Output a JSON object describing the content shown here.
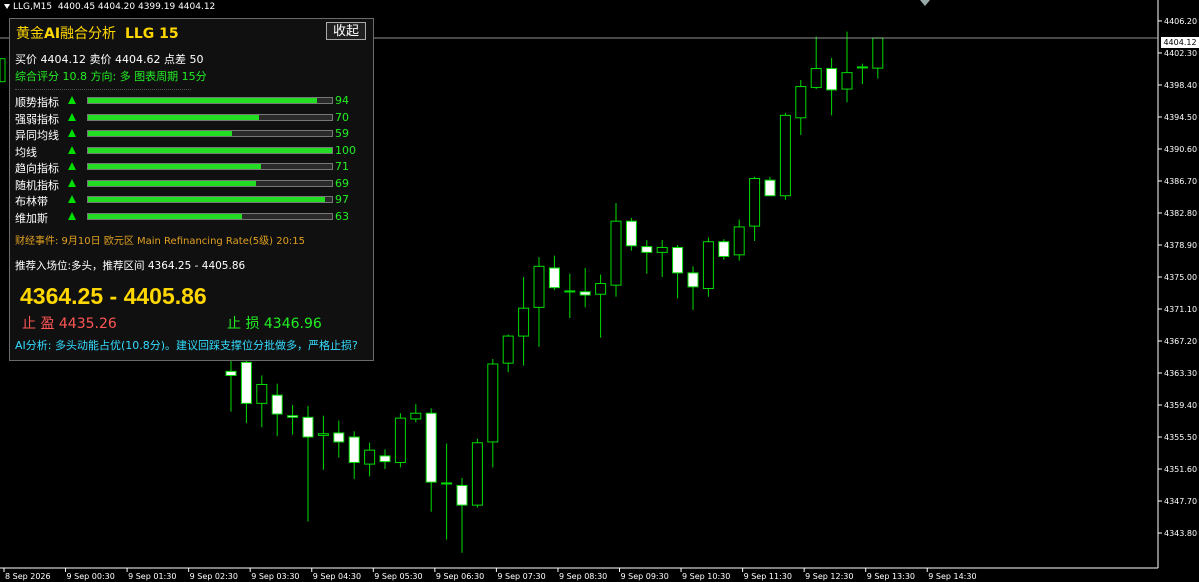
{
  "header": {
    "symbol": "LLG,M15",
    "ohlc": "4400.45 4404.20 4399.19 4404.12"
  },
  "panel": {
    "title_prefix": "黄金",
    "title_ai": "AI",
    "title_suffix": "融合分析",
    "title_code": "LLG 15",
    "collapse_label": "收起",
    "quote_line": "买价 4404.12  卖价 4404.62  点差 50",
    "score_line": "综合评分 10.8  方向: 多  图表周期 15分",
    "indicators": [
      {
        "name": "顺势指标",
        "value": 94
      },
      {
        "name": "强弱指标",
        "value": 70
      },
      {
        "name": "异同均线",
        "value": 59
      },
      {
        "name": "均线",
        "value": 100
      },
      {
        "name": "趋向指标",
        "value": 71
      },
      {
        "name": "随机指标",
        "value": 69
      },
      {
        "name": "布林带",
        "value": 97
      },
      {
        "name": "维加斯",
        "value": 63
      }
    ],
    "event_line": "财经事件: 9月10日 欧元区 Main Refinancing Rate(5级) 20:15",
    "entry_line": "推荐入场位:多头，推荐区间 4364.25 - 4405.86",
    "big_range": "4364.25 - 4405.86",
    "take_profit": "止 盈  4435.26",
    "stop_loss": "止 损  4346.96",
    "ai_line": "AI分析: 多头动能占优(10.8分)。建议回踩支撑位分批做多，严格止损?"
  },
  "colors": {
    "background": "#000000",
    "candle_stroke": "#00dd00",
    "bull_fill": "#000000",
    "bear_fill": "#ffffff",
    "grid": "#1a1a1a",
    "axis": "#ffffff",
    "bid_line": "#c0c0c0",
    "panel_gold": "#ffd700",
    "panel_green": "#22ee22",
    "panel_red": "#ff5555",
    "panel_cyan": "#33ddff",
    "panel_orange": "#e0a020"
  },
  "chart_data": {
    "type": "candlestick",
    "title": "",
    "xlabel": "",
    "ylabel": "",
    "ylim": [
      4340.27,
      4407.9
    ],
    "yticks": [
      4406.2,
      4402.3,
      4398.4,
      4394.5,
      4390.6,
      4386.7,
      4382.8,
      4378.9,
      4375.0,
      4371.1,
      4367.2,
      4363.3,
      4359.4,
      4355.5,
      4351.6,
      4347.7,
      4343.8
    ],
    "current_price": "4404.12",
    "x_labels": [
      "8 Sep 2026",
      "9 Sep 00:30",
      "9 Sep 01:30",
      "9 Sep 02:30",
      "9 Sep 03:30",
      "9 Sep 04:30",
      "9 Sep 05:30",
      "9 Sep 06:30",
      "9 Sep 07:30",
      "9 Sep 08:30",
      "9 Sep 09:30",
      "9 Sep 10:30",
      "9 Sep 11:30",
      "9 Sep 12:30",
      "9 Sep 13:30",
      "9 Sep 14:30"
    ],
    "candles": [
      {
        "o": 4363.5,
        "h": 4368.0,
        "l": 4358.6,
        "c": 4363.0
      },
      {
        "o": 4364.6,
        "h": 4367.2,
        "l": 4357.2,
        "c": 4359.6
      },
      {
        "o": 4359.6,
        "h": 4363.0,
        "l": 4356.7,
        "c": 4361.9
      },
      {
        "o": 4360.6,
        "h": 4362.0,
        "l": 4355.6,
        "c": 4358.3
      },
      {
        "o": 4358.1,
        "h": 4359.4,
        "l": 4355.8,
        "c": 4357.9
      },
      {
        "o": 4357.9,
        "h": 4359.3,
        "l": 4345.2,
        "c": 4355.5
      },
      {
        "o": 4355.7,
        "h": 4358.1,
        "l": 4351.5,
        "c": 4355.9
      },
      {
        "o": 4356.0,
        "h": 4357.5,
        "l": 4353.0,
        "c": 4354.9
      },
      {
        "o": 4355.5,
        "h": 4356.2,
        "l": 4350.4,
        "c": 4352.4
      },
      {
        "o": 4352.2,
        "h": 4354.8,
        "l": 4350.7,
        "c": 4353.9
      },
      {
        "o": 4353.2,
        "h": 4354.0,
        "l": 4351.6,
        "c": 4352.5
      },
      {
        "o": 4352.4,
        "h": 4358.4,
        "l": 4351.8,
        "c": 4357.8
      },
      {
        "o": 4357.7,
        "h": 4359.5,
        "l": 4357.3,
        "c": 4358.4
      },
      {
        "o": 4358.4,
        "h": 4359.0,
        "l": 4346.4,
        "c": 4350.0
      },
      {
        "o": 4349.9,
        "h": 4354.7,
        "l": 4343.0,
        "c": 4349.8
      },
      {
        "o": 4349.6,
        "h": 4350.5,
        "l": 4341.4,
        "c": 4347.2
      },
      {
        "o": 4347.2,
        "h": 4355.3,
        "l": 4346.9,
        "c": 4354.8
      },
      {
        "o": 4354.9,
        "h": 4365.0,
        "l": 4351.8,
        "c": 4364.4
      },
      {
        "o": 4364.5,
        "h": 4368.0,
        "l": 4363.4,
        "c": 4367.8
      },
      {
        "o": 4367.8,
        "h": 4375.0,
        "l": 4364.2,
        "c": 4371.2
      },
      {
        "o": 4371.3,
        "h": 4377.4,
        "l": 4366.5,
        "c": 4376.3
      },
      {
        "o": 4376.1,
        "h": 4377.6,
        "l": 4373.4,
        "c": 4373.7
      },
      {
        "o": 4373.3,
        "h": 4375.4,
        "l": 4370.0,
        "c": 4373.2
      },
      {
        "o": 4373.2,
        "h": 4376.1,
        "l": 4371.3,
        "c": 4372.8
      },
      {
        "o": 4372.9,
        "h": 4375.3,
        "l": 4367.6,
        "c": 4374.2
      },
      {
        "o": 4374.0,
        "h": 4384.0,
        "l": 4372.6,
        "c": 4381.8
      },
      {
        "o": 4381.8,
        "h": 4382.2,
        "l": 4378.2,
        "c": 4378.8
      },
      {
        "o": 4378.7,
        "h": 4379.5,
        "l": 4375.4,
        "c": 4378.0
      },
      {
        "o": 4378.0,
        "h": 4379.5,
        "l": 4375.0,
        "c": 4378.6
      },
      {
        "o": 4378.6,
        "h": 4378.9,
        "l": 4372.4,
        "c": 4375.5
      },
      {
        "o": 4375.5,
        "h": 4376.3,
        "l": 4371.0,
        "c": 4373.8
      },
      {
        "o": 4373.6,
        "h": 4379.8,
        "l": 4372.6,
        "c": 4379.3
      },
      {
        "o": 4379.3,
        "h": 4379.6,
        "l": 4377.1,
        "c": 4377.5
      },
      {
        "o": 4377.7,
        "h": 4382.0,
        "l": 4377.0,
        "c": 4381.1
      },
      {
        "o": 4381.2,
        "h": 4387.2,
        "l": 4379.4,
        "c": 4387.0
      },
      {
        "o": 4386.8,
        "h": 4387.2,
        "l": 4384.9,
        "c": 4384.9
      },
      {
        "o": 4384.9,
        "h": 4395.0,
        "l": 4384.4,
        "c": 4394.7
      },
      {
        "o": 4394.4,
        "h": 4399.0,
        "l": 4392.3,
        "c": 4398.2
      },
      {
        "o": 4398.1,
        "h": 4404.3,
        "l": 4397.9,
        "c": 4400.4
      },
      {
        "o": 4400.4,
        "h": 4401.7,
        "l": 4394.7,
        "c": 4397.8
      },
      {
        "o": 4397.9,
        "h": 4404.9,
        "l": 4396.3,
        "c": 4399.9
      },
      {
        "o": 4400.5,
        "h": 4401.0,
        "l": 4398.5,
        "c": 4400.6
      },
      {
        "o": 4400.45,
        "h": 4404.2,
        "l": 4399.19,
        "c": 4404.12
      }
    ]
  }
}
